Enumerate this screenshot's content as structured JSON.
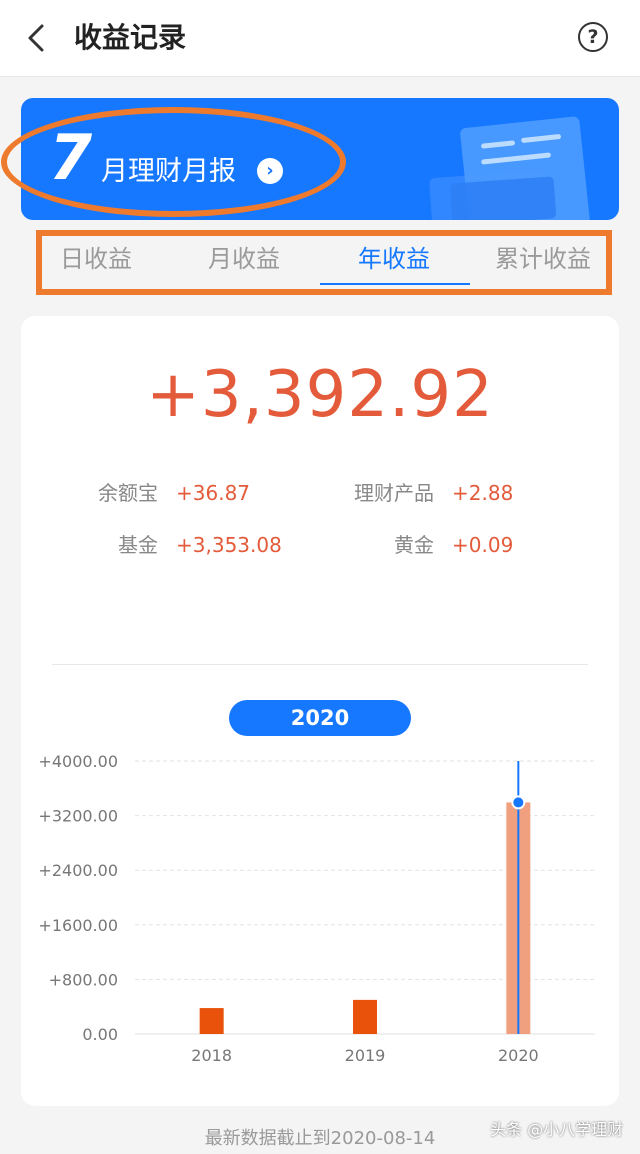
{
  "header": {
    "back_icon": "chevron-left-icon",
    "title": "收益记录",
    "help_icon": "question-circle-icon",
    "help_glyph": "?"
  },
  "banner": {
    "number": "7",
    "text": "月理财月报",
    "arrow_icon": "chevron-right-circle-icon",
    "arrow_glyph": "›",
    "color": "#1677ff"
  },
  "tabs": [
    {
      "label": "日收益",
      "active": false
    },
    {
      "label": "月收益",
      "active": false
    },
    {
      "label": "年收益",
      "active": true
    },
    {
      "label": "累计收益",
      "active": false
    }
  ],
  "summary": {
    "total": "+3,392.92",
    "items": [
      {
        "label": "余额宝",
        "value": "+36.87"
      },
      {
        "label": "理财产品",
        "value": "+2.88"
      },
      {
        "label": "基金",
        "value": "+3,353.08"
      },
      {
        "label": "黄金",
        "value": "+0.09"
      }
    ]
  },
  "year_selector": "2020",
  "chart_data": {
    "type": "bar",
    "categories": [
      "2018",
      "2019",
      "2020"
    ],
    "values": [
      380,
      500,
      3392.92
    ],
    "ylim": [
      0,
      4000
    ],
    "yticks": [
      "+4000.00",
      "+3200.00",
      "+2400.00",
      "+1600.00",
      "+800.00",
      "0.00"
    ],
    "tick_values": [
      4000,
      3200,
      2400,
      1600,
      800,
      0
    ],
    "selected": "2020",
    "colors": {
      "bar": "#e8520a",
      "selected": "#f0a07f",
      "marker": "#1677ff",
      "grid": "#e2e2e2"
    }
  },
  "footer": "最新数据截止到2020-08-14",
  "watermark": "头条 @小八学理财",
  "colors": {
    "accent": "#1677ff",
    "positive": "#e35b3a",
    "highlight": "#ee7a2d"
  }
}
